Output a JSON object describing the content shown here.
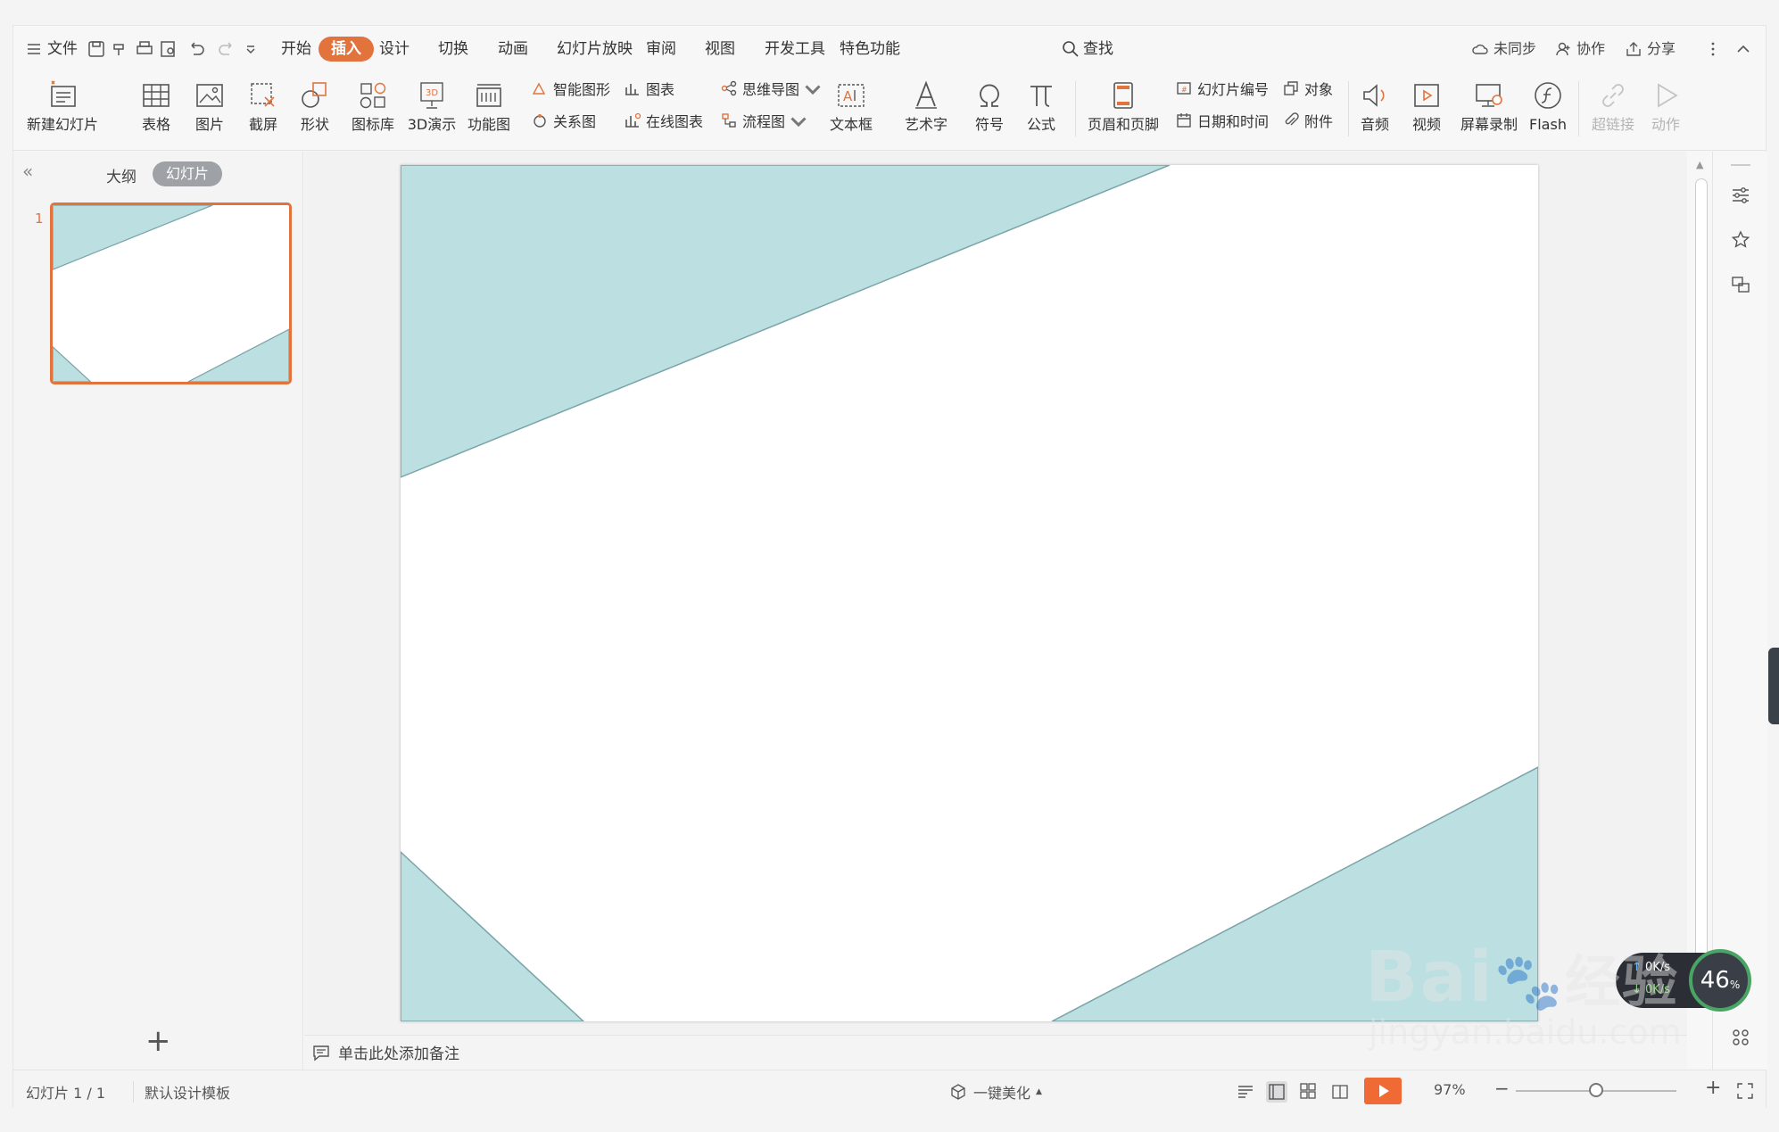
{
  "menu": {
    "hamburger_icon": "menu-icon",
    "file": "文件",
    "tabs": [
      "开始",
      "插入",
      "设计",
      "切换",
      "动画",
      "幻灯片放映",
      "审阅",
      "视图",
      "开发工具",
      "特色功能"
    ],
    "active_tab": "插入",
    "search": "查找",
    "unsynced": "未同步",
    "collaborate": "协作",
    "share": "分享"
  },
  "ribbon": {
    "new_slide": "新建幻灯片",
    "table": "表格",
    "picture": "图片",
    "screenshot": "截屏",
    "shape": "形状",
    "icon_library": "图标库",
    "demo3d": "3D演示",
    "function_chart": "功能图",
    "smart_art": "智能图形",
    "chart": "图表",
    "relation": "关系图",
    "online_chart": "在线图表",
    "mindmap": "思维导图",
    "flowchart": "流程图",
    "textbox": "文本框",
    "wordart": "艺术字",
    "symbol": "符号",
    "formula": "公式",
    "header_footer": "页眉和页脚",
    "slide_number": "幻灯片编号",
    "object": "对象",
    "datetime": "日期和时间",
    "attachment": "附件",
    "audio": "音频",
    "video": "视频",
    "screen_record": "屏幕录制",
    "flash": "Flash",
    "hyperlink": "超链接",
    "action": "动作"
  },
  "left_panel": {
    "collapse": "«",
    "tab_outline": "大纲",
    "tab_slides": "幻灯片",
    "slide_number": "1",
    "add": "+"
  },
  "slide": {
    "accent_color": "#bcdfe1",
    "stroke_color": "#7aa4a8"
  },
  "notes_placeholder": "单击此处添加备注",
  "status": {
    "slide_count": "幻灯片 1 / 1",
    "template": "默认设计模板",
    "beautify": "一键美化",
    "zoom": "97%",
    "zoom_level": 0.5
  },
  "net_monitor": {
    "upload": "0K/s",
    "download": "0K/s",
    "percent": "46",
    "percent_unit": "%"
  },
  "watermark": {
    "brand": "Bai",
    "brand_cn": "经验",
    "url": "jingyan.baidu.com"
  },
  "colors": {
    "accent_orange": "#e2733d",
    "teal_fill": "#bcdfe1"
  }
}
